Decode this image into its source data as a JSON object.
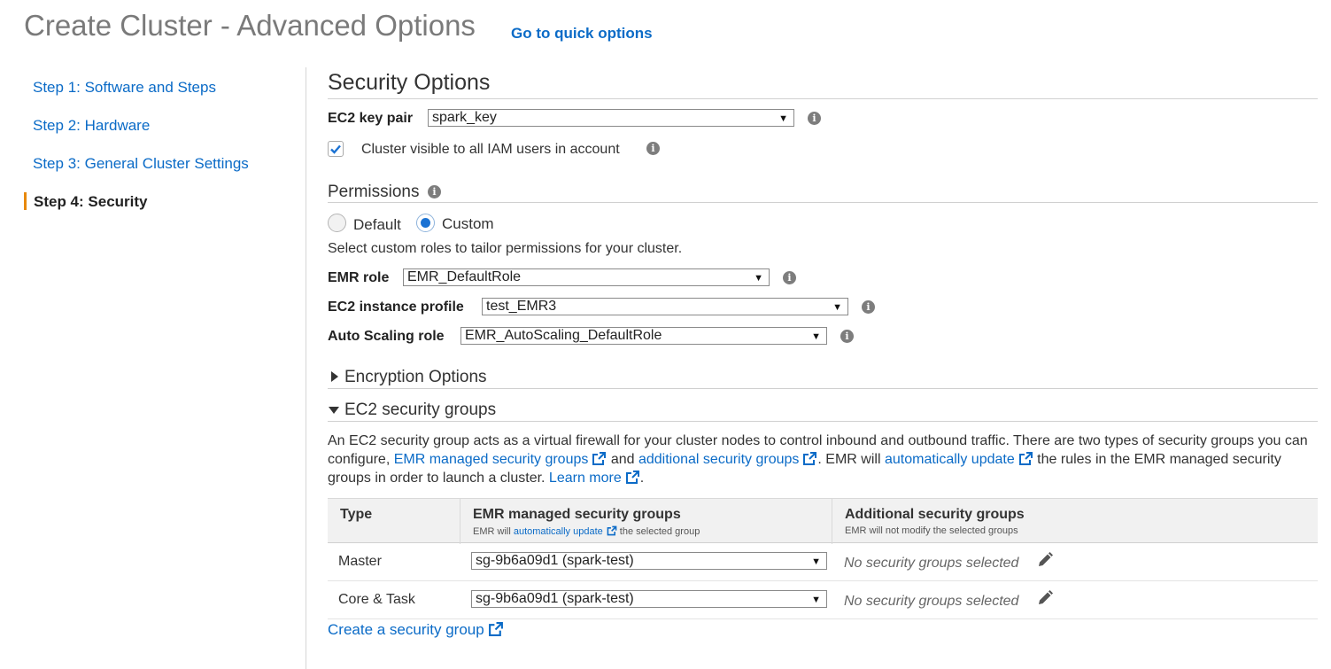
{
  "header": {
    "title": "Create Cluster - Advanced Options",
    "quick_options_link": "Go to quick options"
  },
  "sidebar": {
    "steps": [
      {
        "label": "Step 1: Software and Steps",
        "active": false
      },
      {
        "label": "Step 2: Hardware",
        "active": false
      },
      {
        "label": "Step 3: General Cluster Settings",
        "active": false
      },
      {
        "label": "Step 4: Security",
        "active": true
      }
    ]
  },
  "security_options": {
    "title": "Security Options",
    "ec2_key_pair_label": "EC2 key pair",
    "ec2_key_pair_value": "spark_key",
    "visible_checkbox_label": "Cluster visible to all IAM users in account",
    "visible_checked": true
  },
  "permissions": {
    "title": "Permissions",
    "radio_default": "Default",
    "radio_custom": "Custom",
    "selected": "Custom",
    "help_text": "Select custom roles to tailor permissions for your cluster.",
    "emr_role_label": "EMR role",
    "emr_role_value": "EMR_DefaultRole",
    "ec2_profile_label": "EC2 instance profile",
    "ec2_profile_value": "test_EMR3",
    "autoscaling_label": "Auto Scaling role",
    "autoscaling_value": "EMR_AutoScaling_DefaultRole"
  },
  "encryption": {
    "title": "Encryption Options",
    "expanded": false
  },
  "security_groups": {
    "title": "EC2 security groups",
    "expanded": true,
    "desc_1": "An EC2 security group acts as a virtual firewall for your cluster nodes to control inbound and outbound traffic. There are two types of security groups you can configure, ",
    "link_managed": "EMR managed security groups",
    "desc_2": " and ",
    "link_additional": "additional security groups",
    "desc_3": ". EMR will ",
    "link_auto_update": "automatically update",
    "desc_4": " the rules in the EMR managed security groups in order to launch a cluster. ",
    "link_learn_more": "Learn more",
    "desc_5": ".",
    "table": {
      "col_type": "Type",
      "col_managed": "EMR managed security groups",
      "col_managed_sub_1": "EMR will ",
      "col_managed_sub_link": "automatically update",
      "col_managed_sub_2": " the selected group",
      "col_additional": "Additional security groups",
      "col_additional_sub": "EMR will not modify the selected groups",
      "rows": [
        {
          "type": "Master",
          "managed": "sg-9b6a09d1 (spark-test)",
          "additional": "No security groups selected"
        },
        {
          "type": "Core & Task",
          "managed": "sg-9b6a09d1 (spark-test)",
          "additional": "No security groups selected"
        }
      ]
    },
    "create_link": "Create a security group"
  },
  "icons": {
    "info": "info-icon",
    "external": "external-link-icon",
    "edit": "pencil-icon",
    "dropdown": "chevron-down-icon"
  },
  "colors": {
    "link": "#0b6bc7",
    "active_step_marker": "#e8890c",
    "radio_selected": "#1b72d3",
    "checkbox_check": "#1b72d3"
  }
}
